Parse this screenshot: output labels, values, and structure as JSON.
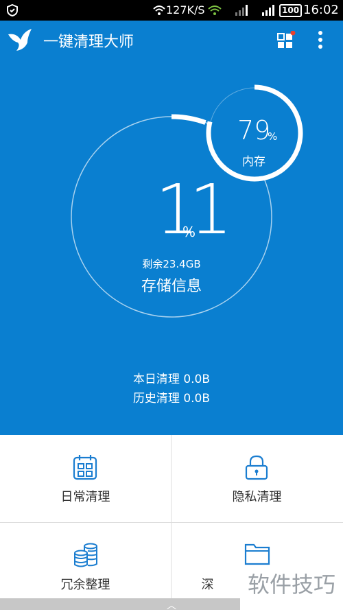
{
  "status_bar": {
    "speed": "127K/S",
    "battery": "100",
    "time": "16:02"
  },
  "header": {
    "title": "一键清理大师"
  },
  "hero": {
    "storage_percent": "11",
    "percent_unit": "%",
    "storage_free": "剩余23.4GB",
    "storage_title": "存储信息",
    "memory_percent": "79",
    "memory_unit": "%",
    "memory_label": "内存",
    "today_clean": "本日清理 0.0B",
    "history_clean": "历史清理 0.0B"
  },
  "grid": [
    {
      "label": "日常清理",
      "icon": "calendar-icon"
    },
    {
      "label": "隐私清理",
      "icon": "lock-icon"
    },
    {
      "label": "冗余整理",
      "icon": "coins-icon"
    },
    {
      "label": "深",
      "icon": "folder-icon"
    }
  ],
  "watermark": "软件技巧",
  "colors": {
    "primary": "#0a7fd0",
    "grid_text": "#333333",
    "icon_blue": "#1a7dd0"
  }
}
